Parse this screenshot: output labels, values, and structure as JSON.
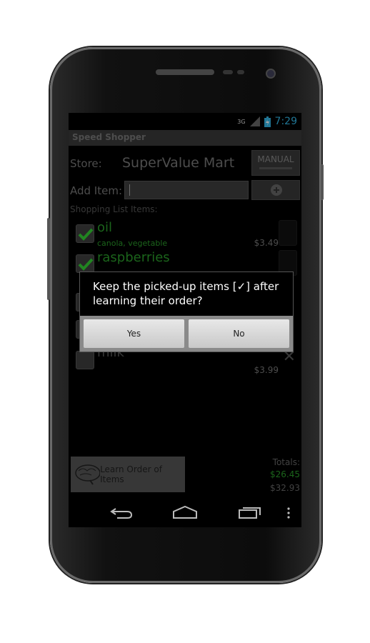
{
  "status": {
    "network": "3G",
    "time": "7:29"
  },
  "app": {
    "title": "Speed Shopper"
  },
  "store": {
    "label": "Store:",
    "name": "SuperValue Mart",
    "mode_button": "MANUAL"
  },
  "add_item": {
    "label": "Add Item:",
    "value": "",
    "add_icon": "plus-circle-icon"
  },
  "list": {
    "label": "Shopping List Items:",
    "items": [
      {
        "name": "oil",
        "detail": "canola, vegetable",
        "price": "$3.49",
        "checked": true
      },
      {
        "name": "raspberries",
        "checked": true
      },
      {
        "name": "milk",
        "price": "$3.99",
        "checked": false
      }
    ]
  },
  "dialog": {
    "message": "Keep the picked-up items [✓] after learning their order?",
    "yes": "Yes",
    "no": "No"
  },
  "footer": {
    "learn_button": "Learn Order of Items",
    "totals_label": "Totals:",
    "picked_total": "$26.45",
    "total": "$32.93"
  },
  "colors": {
    "accent": "#33b5e5",
    "checked_green": "#2a9a2a"
  }
}
